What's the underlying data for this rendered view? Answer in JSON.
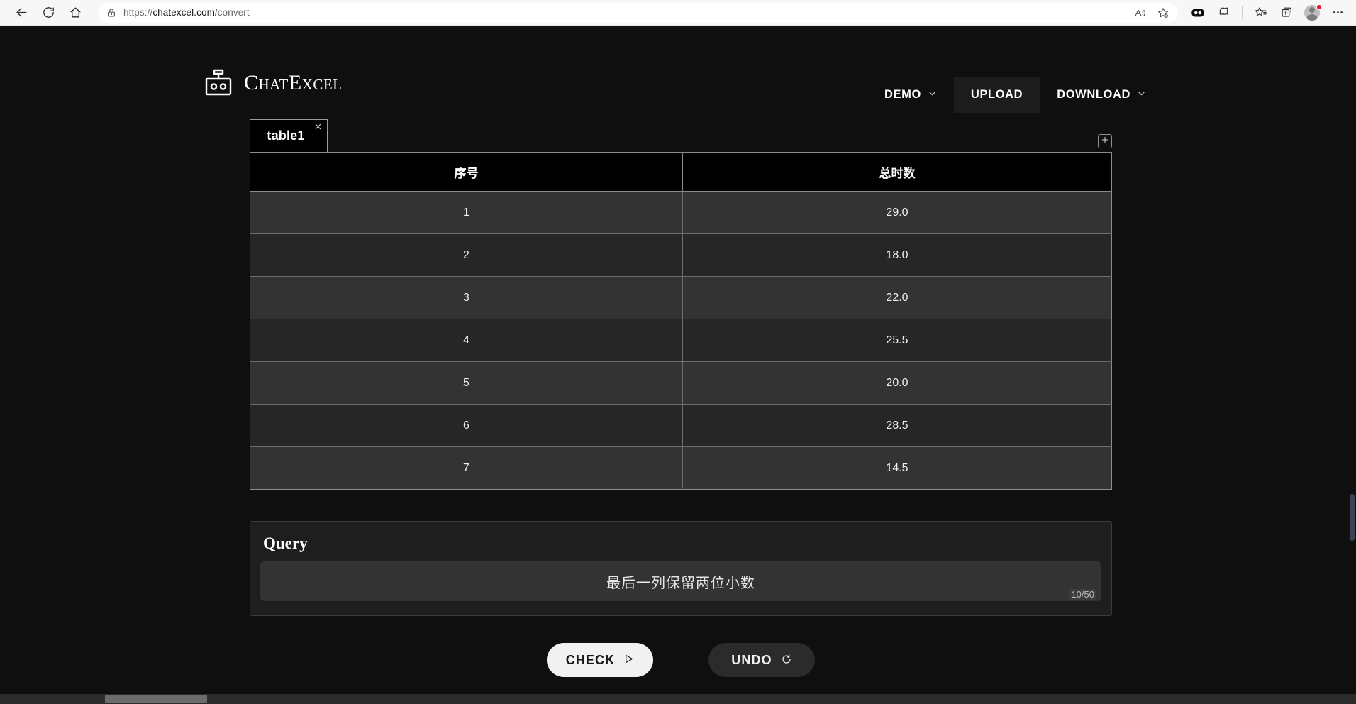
{
  "browser": {
    "url_protocol": "https://",
    "url_host": "chatexcel.com",
    "url_path": "/convert",
    "back_icon": "back-arrow-icon",
    "refresh_icon": "refresh-icon",
    "home_icon": "home-icon",
    "lock_icon": "lock-icon",
    "read_aloud_icon": "read-aloud-icon",
    "favorite_icon": "add-favorite-icon",
    "copilot_icon": "copilot-icon",
    "extensions_icon": "extensions-icon",
    "favorites_icon": "favorites-list-icon",
    "collections_icon": "collections-icon",
    "profile_icon": "profile-avatar-icon",
    "settings_icon": "settings-more-icon"
  },
  "header": {
    "brand_name": "ChatExcel",
    "logo_icon": "robot-head-icon",
    "nav": [
      {
        "label": "DEMO",
        "has_chevron": true,
        "active": false
      },
      {
        "label": "UPLOAD",
        "has_chevron": false,
        "active": true
      },
      {
        "label": "DOWNLOAD",
        "has_chevron": true,
        "active": false
      }
    ]
  },
  "workspace": {
    "tabs": [
      {
        "label": "table1",
        "close_icon": "close-icon"
      }
    ],
    "add_tab_icon": "plus-icon",
    "table": {
      "columns": [
        "序号",
        "总时数"
      ],
      "rows": [
        [
          "1",
          "29.0"
        ],
        [
          "2",
          "18.0"
        ],
        [
          "3",
          "22.0"
        ],
        [
          "4",
          "25.5"
        ],
        [
          "5",
          "20.0"
        ],
        [
          "6",
          "28.5"
        ],
        [
          "7",
          "14.5"
        ]
      ]
    },
    "query": {
      "title": "Query",
      "value": "最后一列保留两位小数",
      "placeholder": "",
      "counter": "10/50"
    },
    "actions": {
      "check_label": "CHECK",
      "check_icon": "play-triangle-icon",
      "undo_label": "UNDO",
      "undo_icon": "undo-arrow-icon"
    }
  },
  "colors": {
    "page_bg": "#0f0f0f",
    "header_text": "#ffffff",
    "table_header_bg": "#000000",
    "row_odd_bg": "#333333",
    "row_even_bg": "#262626",
    "accent_button": "#f1f1f1"
  }
}
